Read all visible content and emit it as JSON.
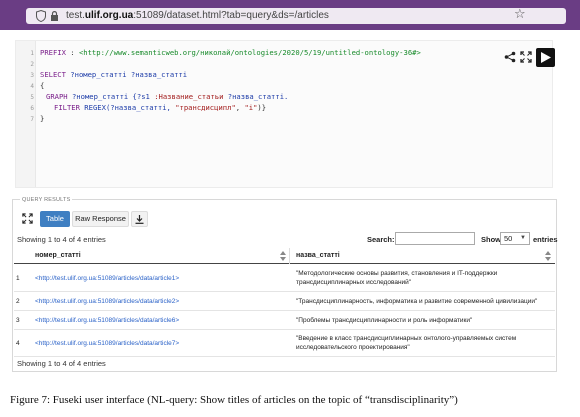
{
  "browser": {
    "url_prefix": "test.",
    "url_domain": "ulif.org.ua",
    "url_rest": ":51089/dataset.html?tab=query&ds=/articles"
  },
  "editor": {
    "line_numbers": [
      "1",
      "2",
      "3",
      "4",
      "5",
      "6",
      "7"
    ],
    "line1": {
      "kw": "PREFIX",
      "sep": " : ",
      "uri": "<http://www.semanticweb.org/николай/ontologies/2020/5/19/untitled-ontology-36#>"
    },
    "line3": {
      "kw": "SELECT",
      "vars": " ?номер_статті ?назва_статті"
    },
    "line4": "{",
    "line5": {
      "kw": "GRAPH",
      "rest": " ?номер_статті {?s1 ",
      "prop": ":Название_статьи",
      "tail": " ?назва_статті."
    },
    "line6": {
      "kw": "FILTER",
      "fn": " REGEX",
      "args": "(?назва_статті, ",
      "str1": "\"трансдисципл\"",
      "comma": ", ",
      "str2": "\"i\"",
      "close": ")}"
    },
    "line7": "}"
  },
  "results": {
    "legend": "QUERY RESULTS",
    "tab_table": "Table",
    "tab_raw": "Raw Response",
    "showing": "Showing 1 to 4 of 4 entries",
    "search_label": "Search:",
    "search_value": "",
    "show_label": "Show",
    "show_value": "50",
    "entries_label": "entries",
    "columns": [
      "номер_статті",
      "назва_статті"
    ],
    "rows": [
      {
        "num": "1",
        "uri": "<http://test.ulif.org.ua:51089/articles/data/article1>",
        "title": "\"Методологические основы развития, становления и IT-поддержки трансдисциплинарных исследований\""
      },
      {
        "num": "2",
        "uri": "<http://test.ulif.org.ua:51089/articles/data/article2>",
        "title": "\"Трансдисциплинарность, информатика и развитие современной цивилизации\""
      },
      {
        "num": "3",
        "uri": "<http://test.ulif.org.ua:51089/articles/data/article6>",
        "title": "\"Проблемы трансдисциплинарности и роль информатики\""
      },
      {
        "num": "4",
        "uri": "<http://test.ulif.org.ua:51089/articles/data/article7>",
        "title": "\"Введение в класс трансдисциплинарных онтолого-управляемых систем исследовательского проектирования\""
      }
    ],
    "showing_bottom": "Showing 1 to 4 of 4 entries"
  },
  "caption": "Figure 7: Fuseki user interface (NL-query: Show titles of articles on the topic of “transdisciplinarity”)",
  "colors": {
    "browser_bar": "#6a3d84",
    "tab_active": "#3f7fc2",
    "link": "#2a62c8",
    "keyword": "#7a1f8a",
    "uri": "#178a2a"
  },
  "icons": [
    "shield-icon",
    "lock-icon",
    "star-icon",
    "share-icon",
    "fullscreen-icon",
    "play-icon",
    "download-icon",
    "sort-icon"
  ]
}
